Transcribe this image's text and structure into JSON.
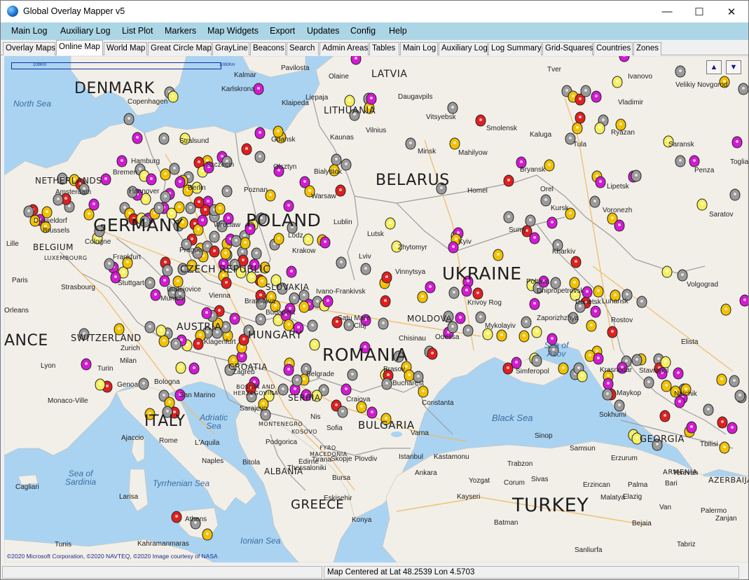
{
  "window": {
    "title": "Global Overlay Mapper v5",
    "minimize": "—",
    "maximize": "☐",
    "close": "✕"
  },
  "menu": [
    "Main Log",
    "Auxiliary Log",
    "List Plot",
    "Markers",
    "Map Widgets",
    "Export",
    "Updates",
    "Config",
    "Help"
  ],
  "tabs": [
    {
      "label": "Overlay Maps"
    },
    {
      "label": "Online Map",
      "active": true
    },
    {
      "label": "World Map"
    },
    {
      "label": "Great Circle Map"
    },
    {
      "label": "GrayLine"
    },
    {
      "label": "Beacons"
    },
    {
      "label": "Search"
    },
    {
      "label": "Admin Areas"
    },
    {
      "label": "Tables"
    },
    {
      "label": "Main Log"
    },
    {
      "label": "Auxiliary Log"
    },
    {
      "label": "Log Summary"
    },
    {
      "label": "Grid-Squares"
    },
    {
      "label": "Countries"
    },
    {
      "label": "Zones"
    }
  ],
  "map": {
    "scale_labels": [
      "100Km",
      "1000Km"
    ],
    "nav_up": "▲",
    "nav_down": "▼",
    "copyright": "©2020 Microsoft Corporation, ©2020 NAVTEQ, ©2020 Image courtesy of NASA",
    "countries": [
      "DENMARK",
      "LATVIA",
      "LITHUANIA",
      "BELARUS",
      "NETHERLANDS",
      "GERMANY",
      "POLAND",
      "BELGIUM",
      "LUXEMBOURG",
      "CZECH REPUBLIC",
      "SLOVAKIA",
      "UKRAINE",
      "AUSTRIA",
      "HUNGARY",
      "MOLDOVA",
      "SWITZERLAND",
      "ROMANIA",
      "CROATIA",
      "BOSNIA AND HERZEGOVINA",
      "SERBIA",
      "ITALY",
      "MONTENEGRO",
      "KOSOVO",
      "BULGARIA",
      "FYRO MACEDONIA",
      "ALBANIA",
      "GREECE",
      "TURKEY",
      "GEORGIA",
      "ARMENIA",
      "AZERBAIJA",
      "ANCE"
    ],
    "seas": [
      "North Sea",
      "Sea of Azov",
      "Black Sea",
      "Adriatic Sea",
      "Sea of Sardinia",
      "Tyrrhenian Sea",
      "Ionian Sea"
    ],
    "cities": [
      "Kalmar",
      "Pavilosta",
      "Olaine",
      "Karlskrona",
      "Klaipeda",
      "Liepaja",
      "Daugavpils",
      "Copenhagen",
      "Tver",
      "Ivanovo",
      "Velikiy Novgorod",
      "Vladimir",
      "Vitsyebsk",
      "Smolensk",
      "Kaluga",
      "Vilnius",
      "Kaunas",
      "Stralsund",
      "Gdansk",
      "Minsk",
      "Mahilyow",
      "Tula",
      "Ryazan",
      "Saransk",
      "Penza",
      "Togliatti",
      "Hamburg",
      "Szczecin",
      "Olsztyn",
      "Bialystok",
      "Bryansk",
      "Lipetsk",
      "Bremen",
      "Berlin",
      "Poznan",
      "Warsaw",
      "Homel",
      "Orel",
      "Kursk",
      "Voronezh",
      "Saratov",
      "Hannover",
      "Amsterdam",
      "Düsseldorf",
      "Brussels",
      "Cologne",
      "Wroclaw",
      "Lodz",
      "Lublin",
      "Lutsk",
      "Sumy",
      "Kharkiv",
      "Frankfurt",
      "Prague",
      "Krakow",
      "Zhytomyr",
      "Kyiv",
      "Lille",
      "Paris",
      "Strasbourg",
      "Stuttgart",
      "Lviv",
      "Vinnytsya",
      "Poltava",
      "Luhansk",
      "Volgograd",
      "Budejovice",
      "Munich",
      "Vienna",
      "Bratislava",
      "Ivano-Frankivsk",
      "Dnipropetrovsk",
      "Donetsk",
      "Orleans",
      "Budapest",
      "Krivoy Rog",
      "Satu Mare",
      "Mykolayiv",
      "Zaporizhzhya",
      "Rostov",
      "Chisinau",
      "Odessa",
      "Elista",
      "Zurich",
      "Zagreb",
      "Klagenfurt",
      "Cluj",
      "Milan",
      "Lyon",
      "Turin",
      "Belgrade",
      "Brasov",
      "Simferopol",
      "Krasnodar",
      "Stavropol",
      "Genoa",
      "Bologna",
      "Sarajevo",
      "Craiova",
      "Bucharest",
      "Constanta",
      "Maykop",
      "Nalchik",
      "Monaco-Ville",
      "San Marino",
      "Nis",
      "Sofia",
      "Varna",
      "Sokhumi",
      "Ajaccio",
      "Rome",
      "L'Aquila",
      "Podgorica",
      "Skopje",
      "Plovdiv",
      "Sinop",
      "Samsun",
      "Tbilisi",
      "Naples",
      "Tirana",
      "Edirne",
      "Istanbul",
      "Kastamonu",
      "Trabzon",
      "Erzurum",
      "Yerevan",
      "Bari",
      "Bitola",
      "Thessaloniki",
      "Bursa",
      "Ankara",
      "Yozgat",
      "Corum",
      "Sivas",
      "Erzincan",
      "Palma",
      "Cagliari",
      "Larisa",
      "Eskisehir",
      "Kayseri",
      "Malatya",
      "Elazig",
      "Van",
      "Palermo",
      "Athens",
      "Konya",
      "Batman",
      "Bejaia",
      "Tunis",
      "Kahramanmaras",
      "Sanliurfa",
      "Tabriz",
      "Zanjan"
    ],
    "status": {
      "left": "",
      "center": "Map Centered at Lat 48.2539  Lon 4.5703",
      "right": ""
    }
  },
  "colors": {
    "water": "#aad3f2",
    "land": "#f2efe9",
    "border": "#9a9a9a",
    "road": "#f0b860",
    "pin_gold": "#f2c100",
    "pin_magenta": "#d21bd2",
    "pin_gray": "#9a9a9a",
    "pin_red": "#e02020",
    "pin_yellow": "#f6ef60",
    "menubar": "#acd6e6"
  }
}
